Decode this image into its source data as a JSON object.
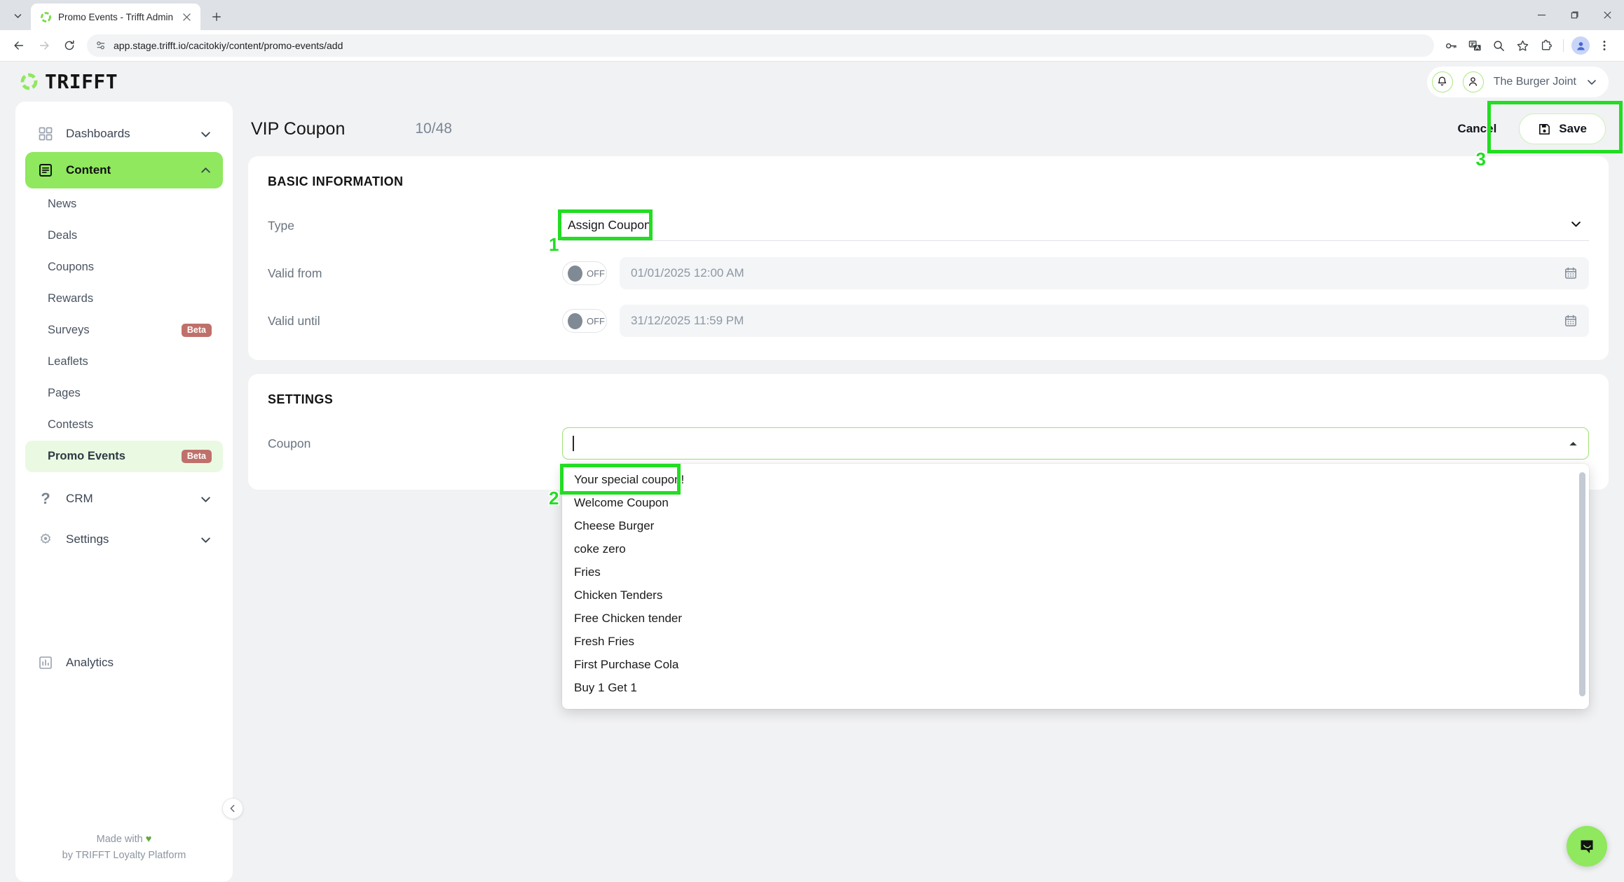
{
  "browser": {
    "tab": {
      "title": "Promo Events - Trifft Admin",
      "favicon_icon": "trifft-ring-icon",
      "close_icon": "close-icon"
    },
    "tabstrip_chevron_icon": "chevron-down-icon",
    "new_tab_icon": "plus-icon",
    "window_controls": [
      "minimize-icon",
      "maximize-icon",
      "close-icon"
    ],
    "back_icon": "arrow-left-icon",
    "forward_icon": "arrow-right-icon",
    "reload_icon": "reload-icon",
    "site_info_icon": "tune-icon",
    "url": "app.stage.trifft.io/cacitokiy/content/promo-events/add",
    "toolbar_icons": [
      "key-icon",
      "translate-icon",
      "zoom-icon",
      "bookmark-star-icon",
      "extensions-puzzle-icon",
      "profile-avatar-icon",
      "chrome-menu-icon"
    ]
  },
  "header": {
    "brand": "TRIFFT",
    "brand_logo_icon": "trifft-ring-icon",
    "notifications_icon": "bell-icon",
    "account_icon": "person-icon",
    "org_name": "The Burger Joint",
    "org_chevron_icon": "chevron-down-icon"
  },
  "sidebar": {
    "items": [
      {
        "label": "Dashboards",
        "icon": "grid-icon",
        "chevron": "chevron-down-icon",
        "active": false
      },
      {
        "label": "Content",
        "icon": "document-list-icon",
        "chevron": "chevron-up-icon",
        "active": true
      }
    ],
    "content_children": [
      {
        "label": "News",
        "badge": "",
        "active": false
      },
      {
        "label": "Deals",
        "badge": "",
        "active": false
      },
      {
        "label": "Coupons",
        "badge": "",
        "active": false
      },
      {
        "label": "Rewards",
        "badge": "",
        "active": false
      },
      {
        "label": "Surveys",
        "badge": "Beta",
        "active": false
      },
      {
        "label": "Leaflets",
        "badge": "",
        "active": false
      },
      {
        "label": "Pages",
        "badge": "",
        "active": false
      },
      {
        "label": "Contests",
        "badge": "",
        "active": false
      },
      {
        "label": "Promo Events",
        "badge": "Beta",
        "active": true
      }
    ],
    "items_after": [
      {
        "label": "CRM",
        "icon": "question-mark-icon",
        "chevron": "chevron-down-icon",
        "active": false
      },
      {
        "label": "Settings",
        "icon": "gear-icon",
        "chevron": "chevron-down-icon",
        "active": false
      }
    ],
    "analytics": {
      "label": "Analytics",
      "icon": "bar-chart-icon"
    },
    "footer_line1": "Made with",
    "footer_heart": "♥",
    "footer_line2": "by TRIFFT Loyalty Platform",
    "collapse_icon": "chevron-left-icon"
  },
  "page": {
    "title": "VIP Coupon",
    "counter": "10/48",
    "cancel_label": "Cancel",
    "save_label": "Save",
    "save_icon": "floppy-disk-icon"
  },
  "basic_information": {
    "section_title": "BASIC INFORMATION",
    "type": {
      "label": "Type",
      "value": "Assign Coupon",
      "chevron_icon": "chevron-down-icon"
    },
    "valid_from": {
      "label": "Valid from",
      "toggle_state": "OFF",
      "value": "01/01/2025 12:00 AM",
      "calendar_icon": "calendar-icon"
    },
    "valid_until": {
      "label": "Valid until",
      "toggle_state": "OFF",
      "value": "31/12/2025 11:59 PM",
      "calendar_icon": "calendar-icon"
    }
  },
  "settings": {
    "section_title": "SETTINGS",
    "coupon": {
      "label": "Coupon",
      "value": "",
      "chevron_icon": "chevron-up-icon",
      "options": [
        "Your special coupon!",
        "Welcome Coupon",
        "Cheese Burger",
        "coke zero",
        "Fries",
        "Chicken Tenders",
        "Free Chicken tender",
        "Fresh Fries",
        "First Purchase Cola",
        "Buy 1 Get 1"
      ]
    }
  },
  "annotations": [
    {
      "number": "1",
      "target": "type-select-value"
    },
    {
      "number": "2",
      "target": "coupon-option-your-special-coupon"
    },
    {
      "number": "3",
      "target": "save-button"
    }
  ],
  "chat_widget": {
    "icon": "chat-bubble-icon"
  },
  "colors": {
    "brand_green": "#8fe85e",
    "annotation_green": "#22dd22",
    "beta_badge": "#c0706a"
  }
}
